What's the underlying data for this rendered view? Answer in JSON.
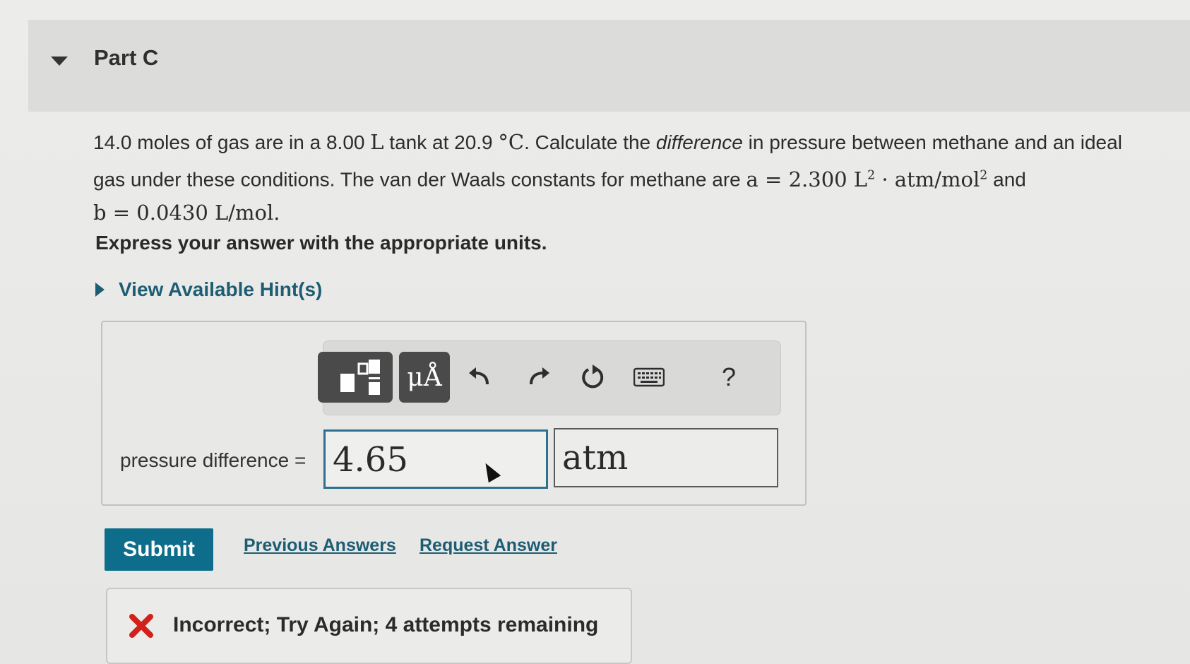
{
  "part": {
    "title": "Part C"
  },
  "problem": {
    "l1_a": "14.0 moles of gas are in a 8.00",
    "l1_unit_L": "L",
    "l1_b": "tank at 20.9",
    "l1_deg": "°C",
    "l1_c": ". Calculate the",
    "l1_em": "difference",
    "l1_d": "in pressure between methane and an ideal",
    "l2_a": "gas under these conditions. The van der Waals constants for methane are",
    "l2_math_a": "a = 2.300 L",
    "l2_sup1": "2",
    "l2_math_b": " · atm/mol",
    "l2_sup2": "2",
    "l2_and": "and",
    "l3_math": "b = 0.0430 L/mol."
  },
  "instruction": "Express your answer with the appropriate units.",
  "hints": {
    "label": "View Available Hint(s)"
  },
  "toolbar": {
    "units_label": "μÅ",
    "help_label": "?"
  },
  "answer": {
    "label": "pressure difference =",
    "value": "4.65",
    "unit": "atm"
  },
  "actions": {
    "submit": "Submit",
    "previous": "Previous Answers",
    "request": "Request Answer"
  },
  "feedback": {
    "text": "Incorrect; Try Again; 4 attempts remaining",
    "color": "#d0221b"
  },
  "colors": {
    "accent": "#0e6d8a",
    "link": "#1d5d73"
  }
}
